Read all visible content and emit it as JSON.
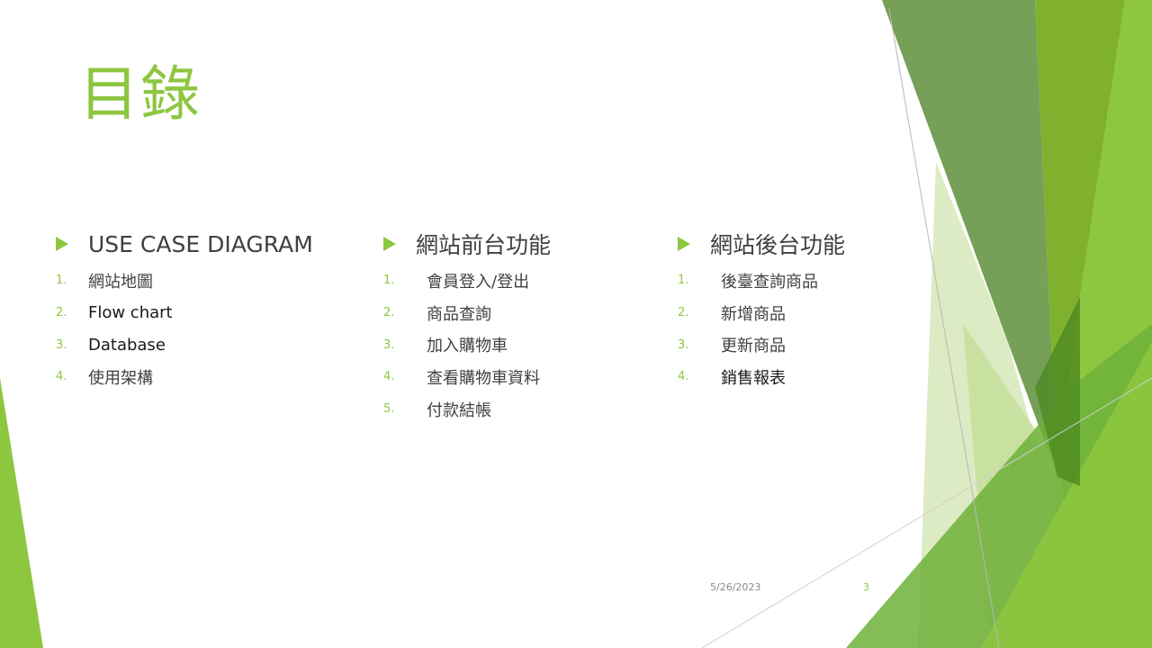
{
  "title": "目錄",
  "columns": [
    {
      "heading": "USE CASE DIAGRAM",
      "items": [
        {
          "num": "1.",
          "text": "網站地圖"
        },
        {
          "num": "2.",
          "text": "Flow chart"
        },
        {
          "num": "3.",
          "text": "Database"
        },
        {
          "num": "4.",
          "text": "使用架構"
        }
      ]
    },
    {
      "heading": "網站前台功能",
      "items": [
        {
          "num": "1.",
          "text": "會員登入/登出"
        },
        {
          "num": "2.",
          "text": "商品查詢"
        },
        {
          "num": "3.",
          "text": "加入購物車"
        },
        {
          "num": "4.",
          "text": "查看購物車資料"
        },
        {
          "num": "5.",
          "text": "付款結帳"
        }
      ]
    },
    {
      "heading": "網站後台功能",
      "items": [
        {
          "num": "1.",
          "text": "後臺查詢商品"
        },
        {
          "num": "2.",
          "text": "新增商品"
        },
        {
          "num": "3.",
          "text": "更新商品"
        },
        {
          "num": "4.",
          "text": "銷售報表"
        }
      ]
    }
  ],
  "footer": {
    "date": "5/26/2023",
    "slide_number": "3"
  },
  "colors": {
    "accent": "#8dc63f",
    "text": "#404040"
  }
}
